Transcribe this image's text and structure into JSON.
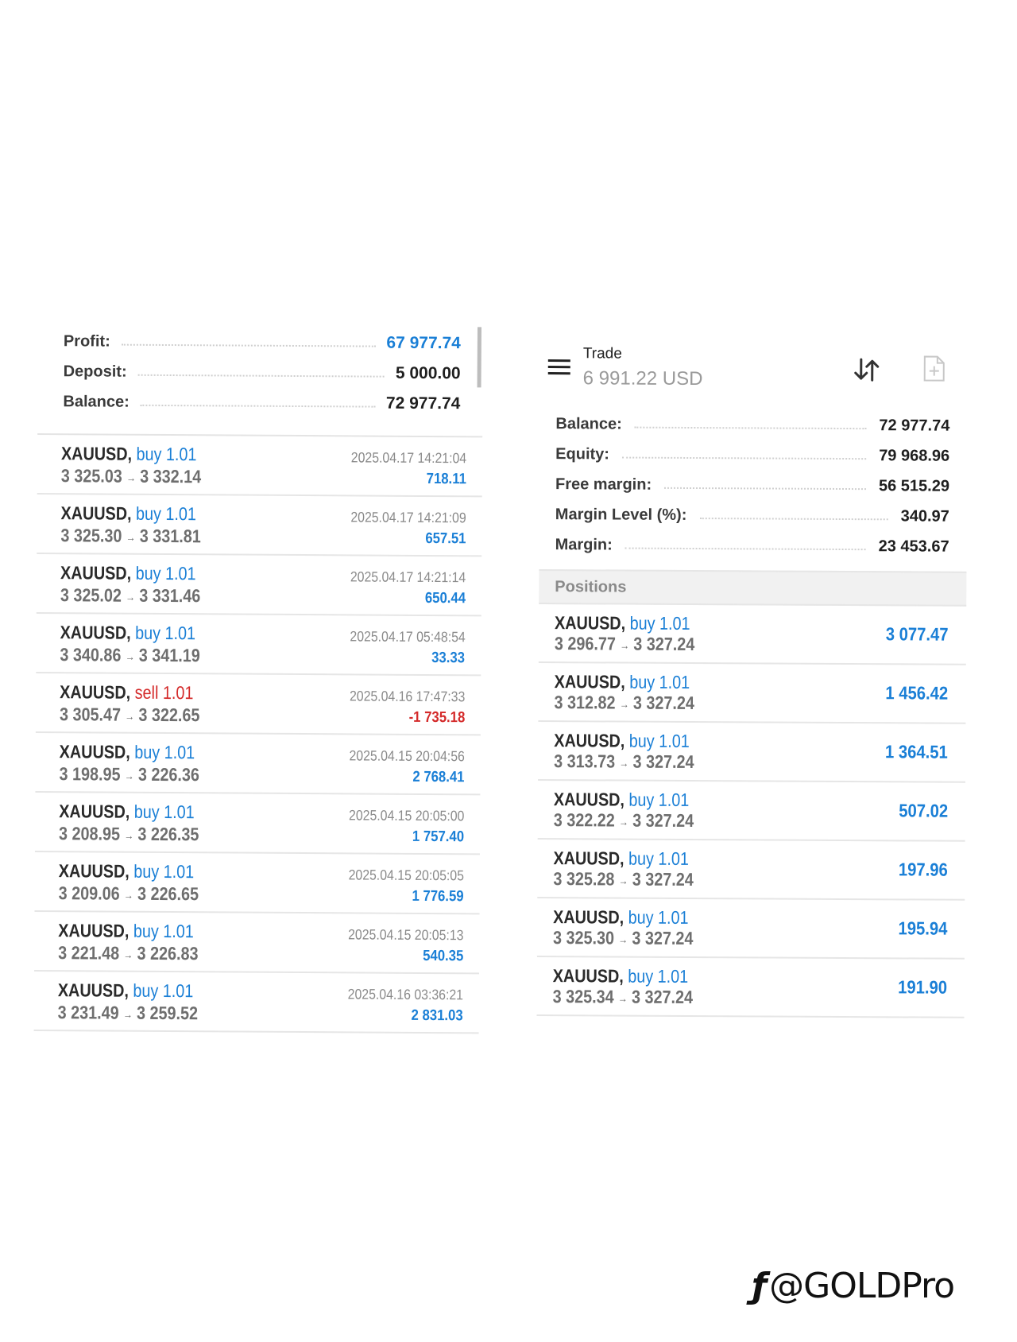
{
  "history": {
    "summary": [
      {
        "label": "Profit:",
        "value": "67 977.74",
        "color": "#1a7fd6"
      },
      {
        "label": "Deposit:",
        "value": "5 000.00",
        "color": "#1f1f1f"
      },
      {
        "label": "Balance:",
        "value": "72 977.74",
        "color": "#1f1f1f"
      }
    ],
    "deals": [
      {
        "symbol": "XAUUSD,",
        "dir": "buy",
        "volume": "1.01",
        "open": "3 325.03",
        "close": "3 332.14",
        "time": "2025.04.17 14:21:04",
        "profit": "718.11",
        "negative": false
      },
      {
        "symbol": "XAUUSD,",
        "dir": "buy",
        "volume": "1.01",
        "open": "3 325.30",
        "close": "3 331.81",
        "time": "2025.04.17 14:21:09",
        "profit": "657.51",
        "negative": false
      },
      {
        "symbol": "XAUUSD,",
        "dir": "buy",
        "volume": "1.01",
        "open": "3 325.02",
        "close": "3 331.46",
        "time": "2025.04.17 14:21:14",
        "profit": "650.44",
        "negative": false
      },
      {
        "symbol": "XAUUSD,",
        "dir": "buy",
        "volume": "1.01",
        "open": "3 340.86",
        "close": "3 341.19",
        "time": "2025.04.17 05:48:54",
        "profit": "33.33",
        "negative": false
      },
      {
        "symbol": "XAUUSD,",
        "dir": "sell",
        "volume": "1.01",
        "open": "3 305.47",
        "close": "3 322.65",
        "time": "2025.04.16 17:47:33",
        "profit": "-1 735.18",
        "negative": true
      },
      {
        "symbol": "XAUUSD,",
        "dir": "buy",
        "volume": "1.01",
        "open": "3 198.95",
        "close": "3 226.36",
        "time": "2025.04.15 20:04:56",
        "profit": "2 768.41",
        "negative": false
      },
      {
        "symbol": "XAUUSD,",
        "dir": "buy",
        "volume": "1.01",
        "open": "3 208.95",
        "close": "3 226.35",
        "time": "2025.04.15 20:05:00",
        "profit": "1 757.40",
        "negative": false
      },
      {
        "symbol": "XAUUSD,",
        "dir": "buy",
        "volume": "1.01",
        "open": "3 209.06",
        "close": "3 226.65",
        "time": "2025.04.15 20:05:05",
        "profit": "1 776.59",
        "negative": false
      },
      {
        "symbol": "XAUUSD,",
        "dir": "buy",
        "volume": "1.01",
        "open": "3 221.48",
        "close": "3 226.83",
        "time": "2025.04.15 20:05:13",
        "profit": "540.35",
        "negative": false
      },
      {
        "symbol": "XAUUSD,",
        "dir": "buy",
        "volume": "1.01",
        "open": "3 231.49",
        "close": "3 259.52",
        "time": "2025.04.16 03:36:21",
        "profit": "2 831.03",
        "negative": false
      }
    ]
  },
  "trade": {
    "title": "Trade",
    "subtitle": "6 991.22 USD",
    "menu_icon": "hamburger-menu-icon",
    "sort_icon": "sort-arrows-icon",
    "new_order_icon": "new-document-icon",
    "account": [
      {
        "label": "Balance:",
        "value": "72 977.74"
      },
      {
        "label": "Equity:",
        "value": "79 968.96"
      },
      {
        "label": "Free margin:",
        "value": "56 515.29"
      },
      {
        "label": "Margin Level (%):",
        "value": "340.97"
      },
      {
        "label": "Margin:",
        "value": "23 453.67"
      }
    ],
    "positions_header": "Positions",
    "positions": [
      {
        "symbol": "XAUUSD,",
        "dir": "buy",
        "volume": "1.01",
        "open": "3 296.77",
        "current": "3 327.24",
        "profit": "3 077.47"
      },
      {
        "symbol": "XAUUSD,",
        "dir": "buy",
        "volume": "1.01",
        "open": "3 312.82",
        "current": "3 327.24",
        "profit": "1 456.42"
      },
      {
        "symbol": "XAUUSD,",
        "dir": "buy",
        "volume": "1.01",
        "open": "3 313.73",
        "current": "3 327.24",
        "profit": "1 364.51"
      },
      {
        "symbol": "XAUUSD,",
        "dir": "buy",
        "volume": "1.01",
        "open": "3 322.22",
        "current": "3 327.24",
        "profit": "507.02"
      },
      {
        "symbol": "XAUUSD,",
        "dir": "buy",
        "volume": "1.01",
        "open": "3 325.28",
        "current": "3 327.24",
        "profit": "197.96"
      },
      {
        "symbol": "XAUUSD,",
        "dir": "buy",
        "volume": "1.01",
        "open": "3 325.30",
        "current": "3 327.24",
        "profit": "195.94"
      },
      {
        "symbol": "XAUUSD,",
        "dir": "buy",
        "volume": "1.01",
        "open": "3 325.34",
        "current": "3 327.24",
        "profit": "191.90"
      }
    ]
  },
  "arrow_glyph": "→",
  "colors": {
    "buy": "#1a7fd6",
    "sell": "#d42a2a",
    "profit_positive": "#1a7fd6",
    "profit_negative": "#d42a2a"
  },
  "watermark": {
    "text": "@GOLDPro",
    "logo_icon": "platform-logo-icon"
  }
}
